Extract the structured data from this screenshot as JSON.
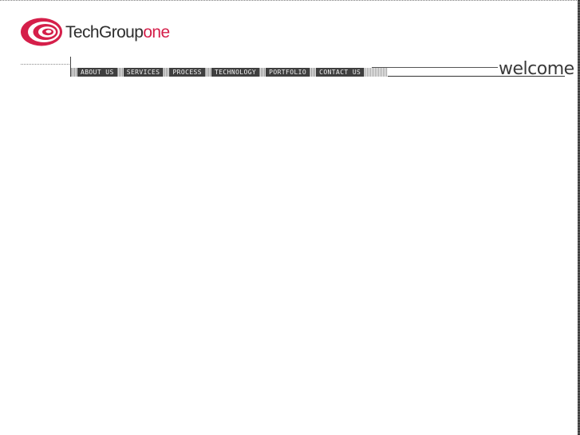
{
  "brand": {
    "name_main": "TechGroup",
    "name_accent": "one",
    "logo_icon": "concentric-rings-logo-icon",
    "colors": {
      "accent": "#d51f4a",
      "text": "#2d2d2d"
    }
  },
  "nav": {
    "items": [
      {
        "label": "ABOUT US"
      },
      {
        "label": "SERVICES"
      },
      {
        "label": "PROCESS"
      },
      {
        "label": "TECHNOLOGY"
      },
      {
        "label": "PORTFOLIO"
      },
      {
        "label": "CONTACT US"
      }
    ],
    "colors": {
      "item_bg": "#3f3f3f",
      "item_text": "#f2f2f2"
    }
  },
  "page": {
    "heading": "welcome"
  }
}
